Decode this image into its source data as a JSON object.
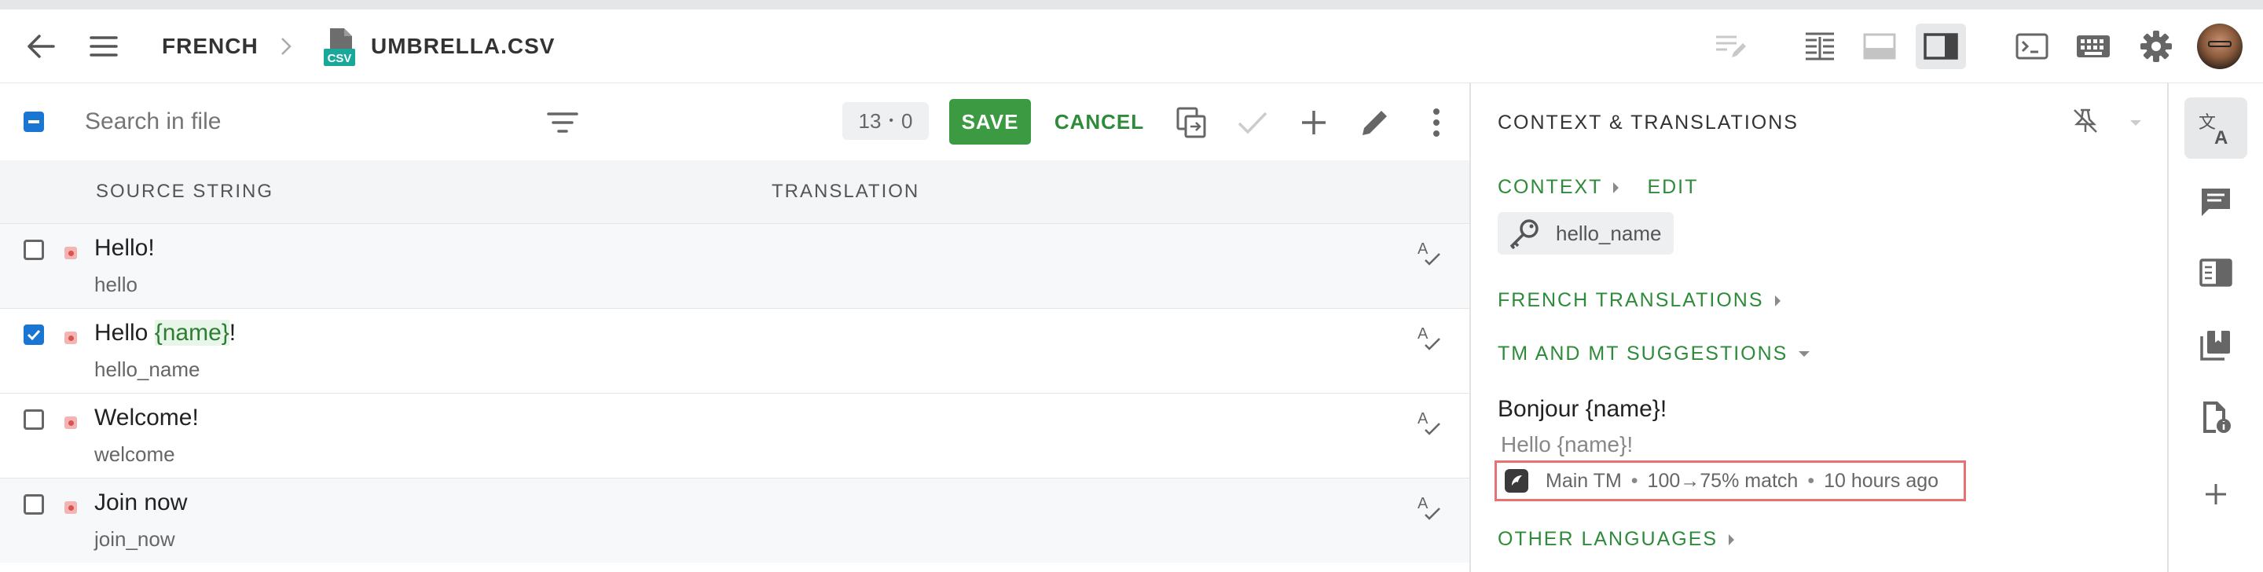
{
  "header": {
    "language": "FRENCH",
    "file_name": "UMBRELLA.CSV",
    "file_badge": "CSV",
    "icons": [
      "arrow-back-icon",
      "menu-icon",
      "chevron-right-icon",
      "csv-file-icon",
      "edit-note-icon",
      "table-layout-icon",
      "bottom-panel-layout-icon",
      "side-panel-layout-icon",
      "terminal-icon",
      "keyboard-icon",
      "settings-icon",
      "avatar"
    ]
  },
  "toolbar": {
    "search_placeholder": "Search in file",
    "counter_left": "13",
    "counter_right": "0",
    "save_label": "SAVE",
    "cancel_label": "CANCEL"
  },
  "table": {
    "col_source": "SOURCE STRING",
    "col_translation": "TRANSLATION",
    "rows": [
      {
        "source": "Hello!",
        "key": "hello",
        "checked": false
      },
      {
        "source_pre": "Hello ",
        "source_ph": "{name}",
        "source_post": "!",
        "key": "hello_name",
        "checked": true
      },
      {
        "source": "Welcome!",
        "key": "welcome",
        "checked": false
      },
      {
        "source": "Join now",
        "key": "join_now",
        "checked": false
      }
    ]
  },
  "panel": {
    "title": "CONTEXT & TRANSLATIONS",
    "context_label": "CONTEXT",
    "edit_label": "EDIT",
    "context_key": "hello_name",
    "french_translations": "FRENCH TRANSLATIONS",
    "tm_mt": "TM AND MT SUGGESTIONS",
    "suggestion_text": "Bonjour {name}!",
    "suggestion_source": "Hello {name}!",
    "tm_name": "Main TM",
    "match": "100→75% match",
    "time": "10 hours ago",
    "other_languages": "OTHER LANGUAGES"
  },
  "colors": {
    "green": "#3c9a43",
    "blue_checkbox": "#1976d2",
    "highlight_red": "#e57373"
  }
}
